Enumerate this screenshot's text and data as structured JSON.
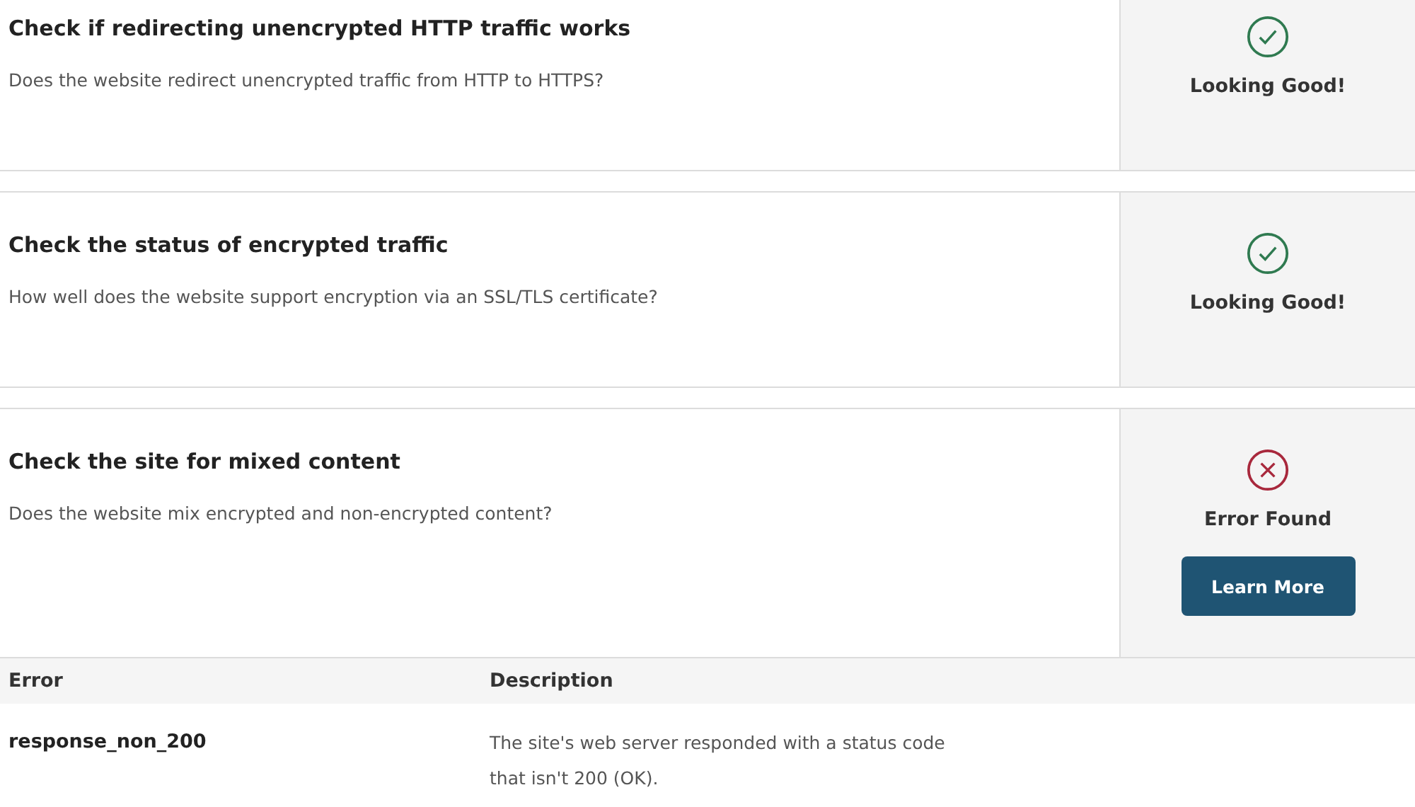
{
  "checks": [
    {
      "title": "Check if redirecting unencrypted HTTP traffic works",
      "description": "Does the website redirect unencrypted traffic from HTTP to HTTPS?",
      "status": {
        "kind": "ok",
        "label": "Looking Good!"
      }
    },
    {
      "title": "Check the status of encrypted traffic",
      "description": "How well does the website support encryption via an SSL/TLS certificate?",
      "status": {
        "kind": "ok",
        "label": "Looking Good!"
      }
    },
    {
      "title": "Check the site for mixed content",
      "description": "Does the website mix encrypted and non-encrypted content?",
      "status": {
        "kind": "error",
        "label": "Error Found",
        "button": "Learn More"
      }
    }
  ],
  "errors_table": {
    "columns": [
      "Error",
      "Description"
    ],
    "rows": [
      {
        "error": "response_non_200",
        "description": "The site's web server responded with a status code that isn't 200 (OK)."
      }
    ]
  }
}
